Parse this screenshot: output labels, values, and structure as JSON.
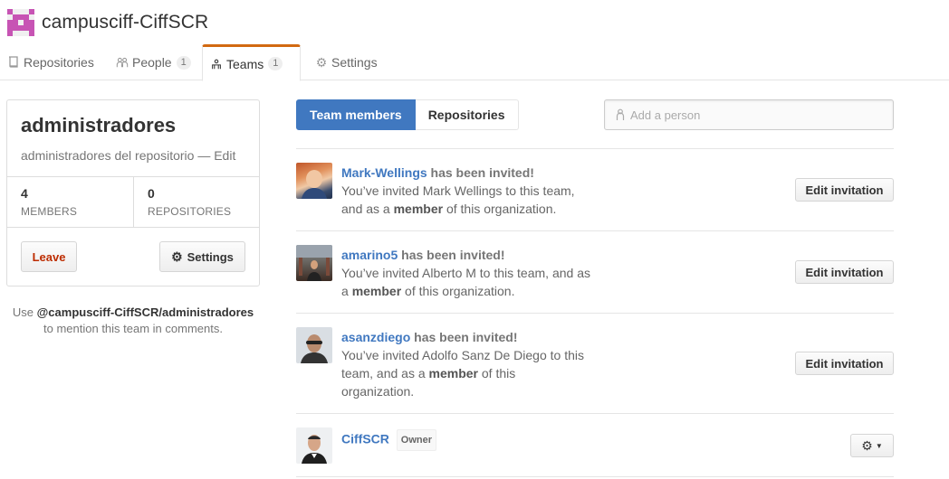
{
  "org": {
    "name": "campusciff-CiffSCR",
    "avatar_color": "#c754b4"
  },
  "tabs": [
    {
      "label": "Repositories",
      "icon": "repo-icon"
    },
    {
      "label": "People",
      "count": "1",
      "icon": "people-icon"
    },
    {
      "label": "Teams",
      "count": "1",
      "icon": "team-icon",
      "selected": true
    },
    {
      "label": "Settings",
      "icon": "gear-icon"
    }
  ],
  "team": {
    "name": "administradores",
    "description": "administradores del repositorio",
    "separator": "—",
    "edit_label": "Edit",
    "members_count": "4",
    "members_label": "MEMBERS",
    "repos_count": "0",
    "repos_label": "REPOSITORIES",
    "leave_label": "Leave",
    "settings_label": "Settings"
  },
  "mention": {
    "prefix": "Use",
    "handle": "@campusciff-CiffSCR/administradores",
    "suffix": "to mention this team in comments."
  },
  "subnav": {
    "members_label": "Team members",
    "repos_label": "Repositories"
  },
  "add_person": {
    "placeholder": "Add a person"
  },
  "members": [
    {
      "login": "Mark-Wellings",
      "status": "has been invited!",
      "line_a": "You’ve invited Mark Wellings to this team, and as a",
      "role": "member",
      "line_b": "of this organization.",
      "button": "Edit invitation"
    },
    {
      "login": "amarino5",
      "status": "has been invited!",
      "line_a": "You’ve invited Alberto M to this team, and as a",
      "role": "member",
      "line_b": "of this organization.",
      "button": "Edit invitation"
    },
    {
      "login": "asanzdiego",
      "status": "has been invited!",
      "line_a": "You’ve invited Adolfo Sanz De Diego to this team, and as a",
      "role": "member",
      "line_b": "of this organization.",
      "button": "Edit invitation"
    },
    {
      "login": "CiffSCR",
      "badge": "Owner"
    }
  ],
  "colors": {
    "accent": "#4078c0",
    "tab_highlight": "#d26911",
    "danger": "#bd2c00"
  }
}
